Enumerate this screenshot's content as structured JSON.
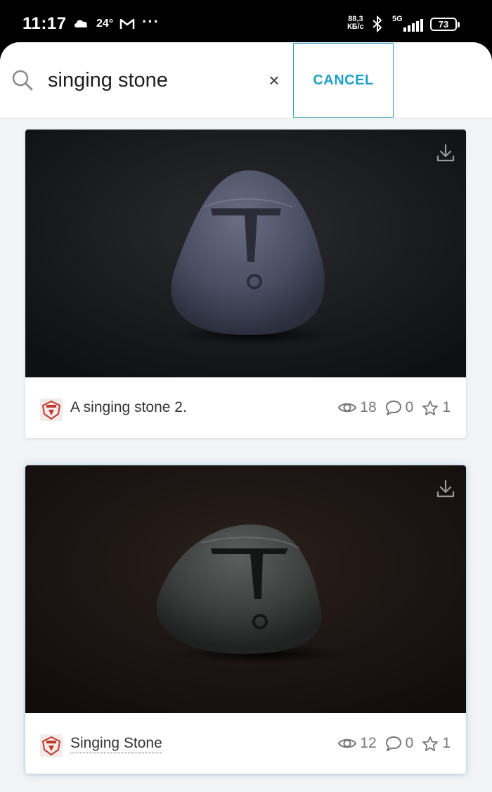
{
  "status_bar": {
    "time": "11:17",
    "temperature": "24°",
    "more": "···",
    "net_speed_value": "88,3",
    "net_speed_unit": "КБ/с",
    "network_type": "5G",
    "battery": "73"
  },
  "search": {
    "query": "singing stone",
    "placeholder": "",
    "cancel_label": "CANCEL"
  },
  "results": [
    {
      "title": "A singing stone 2.",
      "views": "18",
      "comments": "0",
      "likes": "1",
      "background": "#141518",
      "stone_color": "#4a4e63"
    },
    {
      "title": "Singing Stone",
      "views": "12",
      "comments": "0",
      "likes": "1",
      "background": "#1b1412",
      "stone_color": "#3b3f3e"
    }
  ],
  "colors": {
    "accent": "#1fa0c8",
    "app_background": "#f2f3f5"
  },
  "icons": [
    "search-icon",
    "clear-icon",
    "download-icon",
    "eye-icon",
    "comment-icon",
    "star-icon"
  ]
}
